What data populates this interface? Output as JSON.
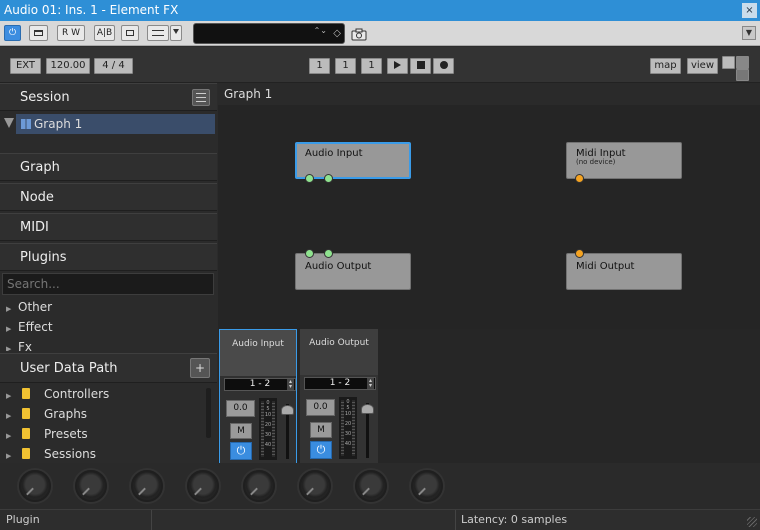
{
  "window": {
    "title": "Audio 01: Ins. 1 - Element FX",
    "close_glyph": "×"
  },
  "plugin_toolbar": {
    "power_glyph": "⏻",
    "rw_label": "R W",
    "ab_label": "A|B",
    "preset_arrows": "⌃⌄",
    "fav_glyph": "◇",
    "menu_glyph": "▼"
  },
  "transport": {
    "sync": "EXT",
    "tempo": "120.00",
    "time_sig": "4 / 4",
    "bar": "1",
    "beat": "1",
    "tick": "1",
    "map_label": "map",
    "view_label": "view"
  },
  "left": {
    "session": "Session",
    "graph_item": "Graph 1",
    "graph": "Graph",
    "node": "Node",
    "midi": "MIDI",
    "plugins": "Plugins",
    "search_placeholder": "Search...",
    "categories": [
      "Other",
      "Effect",
      "Fx"
    ],
    "user_data_path": "User Data Path",
    "add_glyph": "+",
    "folders": [
      "Controllers",
      "Graphs",
      "Presets",
      "Sessions"
    ]
  },
  "graph": {
    "title": "Graph 1",
    "nodes": {
      "audio_input": "Audio Input",
      "midi_input": "Midi Input",
      "midi_input_sub": "(no device)",
      "audio_output": "Audio Output",
      "midi_output": "Midi Output"
    }
  },
  "mixer": {
    "strips": [
      {
        "name": "Audio Input",
        "route": "1 - 2",
        "gain": "0.0",
        "mute": "M"
      },
      {
        "name": "Audio Output",
        "route": "1 - 2",
        "gain": "0.0",
        "mute": "M"
      }
    ],
    "power_glyph": "⏻",
    "scale": [
      "0",
      "5",
      "10",
      "20",
      "30",
      "40"
    ]
  },
  "status": {
    "left": "Plugin",
    "latency": "Latency: 0 samples"
  },
  "colors": {
    "accent": "#2e8fd6",
    "selection": "#3a9be8",
    "audio_port": "#8fe38f",
    "midi_port": "#f5a321"
  }
}
